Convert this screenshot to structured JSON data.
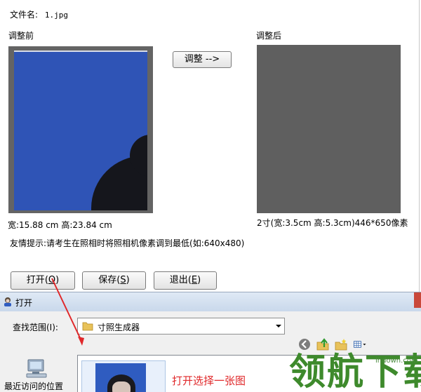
{
  "app": {
    "filename_label": "文件名:",
    "filename_value": "1.jpg",
    "before_label": "调整前",
    "after_label": "调整后",
    "adjust_button": "调整 -->",
    "size_before": "宽:15.88 cm 高:23.84 cm",
    "size_after": "2寸(宽:3.5cm 高:5.3cm)446*650像素",
    "tip": "友情提示:请考生在照相时将照相机像素调到最低(如:640x480)",
    "buttons": {
      "open": "打开",
      "open_key": "O",
      "save": "保存",
      "save_key": "S",
      "exit": "退出",
      "exit_key": "E"
    },
    "colors": {
      "photo_background": "#2f54b6",
      "after_panel": "#5f5f5f"
    }
  },
  "dialog": {
    "title": "打开",
    "lookin_label": "查找范围(I):",
    "lookin_value": "寸照生成器",
    "places": [
      {
        "label": "最近访问的位置",
        "icon": "recent-places-icon"
      }
    ],
    "toolbar_icons": [
      "back-icon",
      "up-folder-icon",
      "new-folder-icon",
      "view-menu-icon"
    ]
  },
  "annotation": {
    "text": "打开选择一张图",
    "color": "#e0282a"
  },
  "watermark": {
    "text": "领航下载",
    "host": "lhdown.com"
  }
}
